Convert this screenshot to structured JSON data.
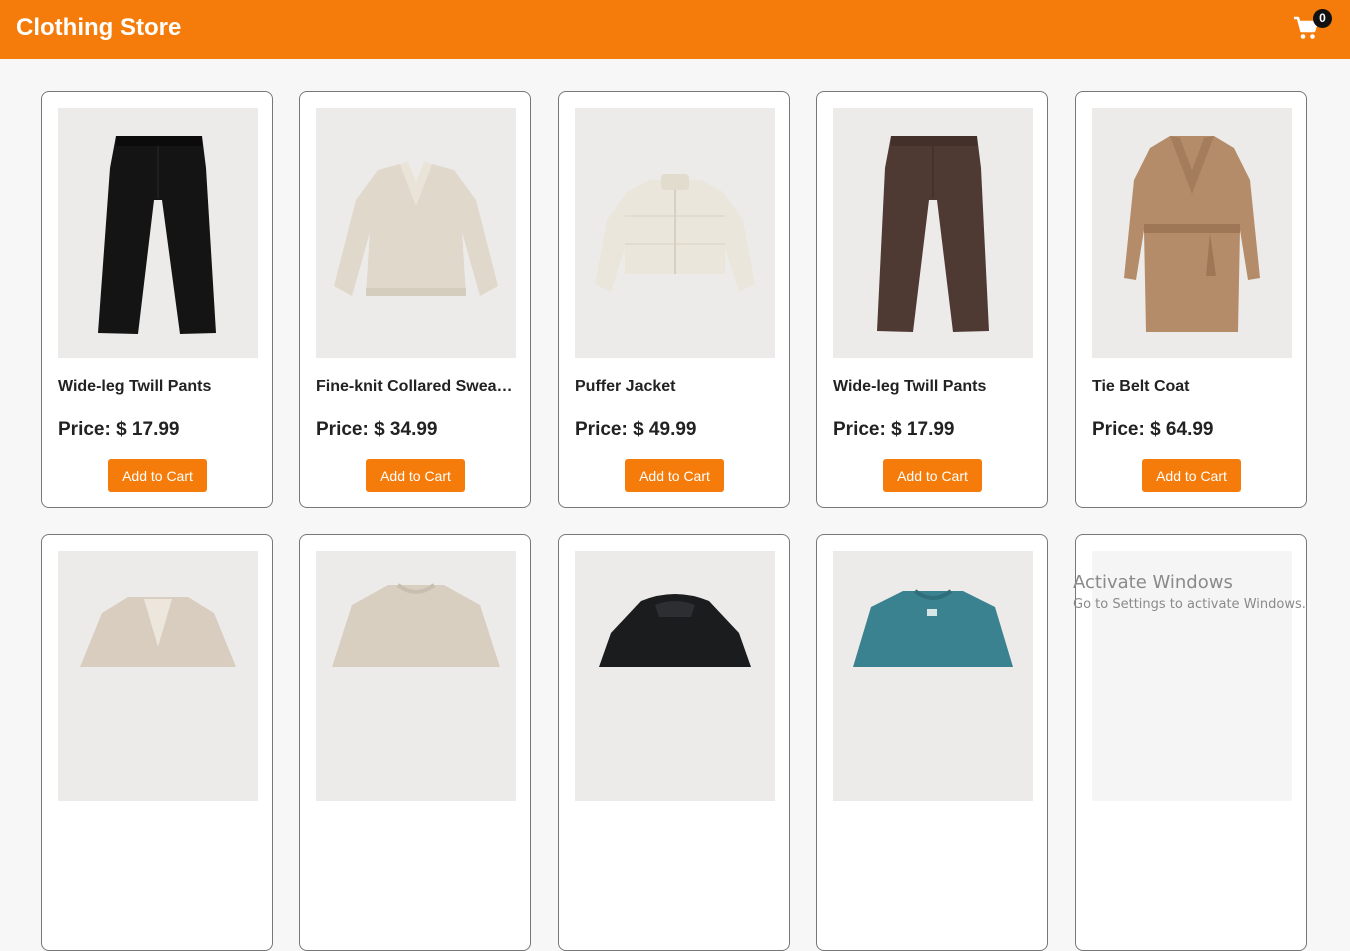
{
  "header": {
    "title": "Clothing Store",
    "cart_icon": "shopping-cart-icon",
    "cart_count": "0",
    "bg_color": "#f57c0a"
  },
  "products": [
    {
      "name": "Wide-leg Twill Pants",
      "price": "Price: $ 17.99",
      "button": "Add to Cart",
      "image": "black-pants-image"
    },
    {
      "name": "Fine-knit Collared Sweater",
      "price": "Price: $ 34.99",
      "button": "Add to Cart",
      "image": "cream-sweater-image"
    },
    {
      "name": "Puffer Jacket",
      "price": "Price: $ 49.99",
      "button": "Add to Cart",
      "image": "cream-puffer-jacket-image"
    },
    {
      "name": "Wide-leg Twill Pants",
      "price": "Price: $ 17.99",
      "button": "Add to Cart",
      "image": "brown-pants-image"
    },
    {
      "name": "Tie Belt Coat",
      "price": "Price: $ 64.99",
      "button": "Add to Cart",
      "image": "camel-coat-image"
    },
    {
      "image": "beige-blazer-image"
    },
    {
      "image": "beige-knit-sweater-image"
    },
    {
      "image": "black-puffer-jacket-image"
    },
    {
      "image": "teal-sweater-image"
    },
    {
      "image": "blank-image"
    }
  ],
  "watermark": {
    "line1": "Activate Windows",
    "line2": "Go to Settings to activate Windows."
  }
}
